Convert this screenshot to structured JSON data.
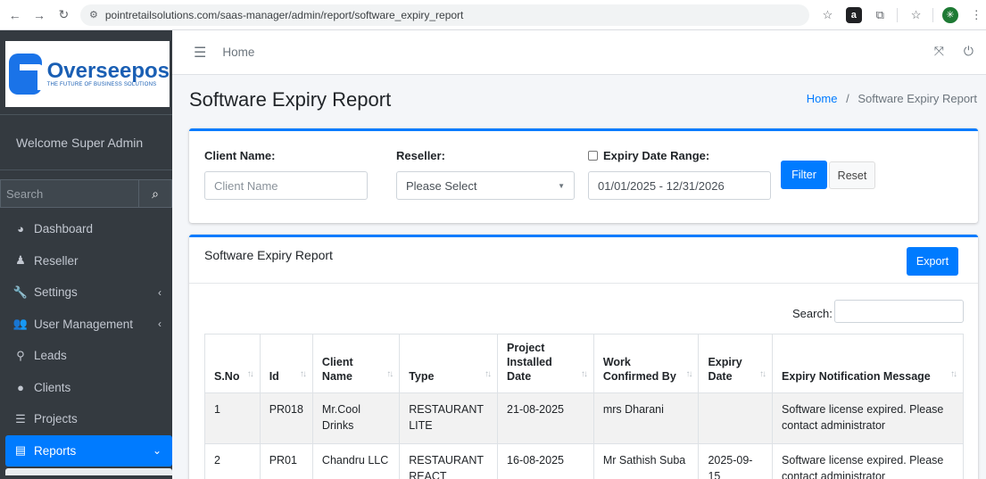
{
  "browser": {
    "url": "pointretailsolutions.com/saas-manager/admin/report/software_expiry_report"
  },
  "sidebar": {
    "brand_name": "Overseepos",
    "brand_tagline": "THE FUTURE OF BUSINESS SOLUTIONS",
    "welcome": "Welcome Super Admin",
    "search_placeholder": "Search",
    "items": [
      {
        "label": "Dashboard",
        "icon": "dashboard-icon"
      },
      {
        "label": "Reseller",
        "icon": "reseller-icon"
      },
      {
        "label": "Settings",
        "icon": "wrench-icon",
        "has_children": true
      },
      {
        "label": "User Management",
        "icon": "users-icon",
        "has_children": true
      },
      {
        "label": "Leads",
        "icon": "leads-icon"
      },
      {
        "label": "Clients",
        "icon": "user-icon"
      },
      {
        "label": "Projects",
        "icon": "database-icon"
      },
      {
        "label": "Reports",
        "icon": "clipboard-icon",
        "active": true,
        "expanded": true
      }
    ]
  },
  "topbar": {
    "home_label": "Home"
  },
  "header": {
    "title": "Software Expiry Report",
    "breadcrumb_home": "Home",
    "breadcrumb_sep": "/",
    "breadcrumb_current": "Software Expiry Report"
  },
  "filters": {
    "client_label": "Client Name:",
    "client_placeholder": "Client Name",
    "reseller_label": "Reseller:",
    "reseller_value": "Please Select",
    "expiry_label": "Expiry Date Range:",
    "expiry_value": "01/01/2025 - 12/31/2026",
    "filter_button": "Filter",
    "reset_button": "Reset"
  },
  "report": {
    "title": "Software Expiry Report",
    "export_button": "Export",
    "search_label": "Search:",
    "columns": [
      "S.No",
      "Id",
      "Client Name",
      "Type",
      "Project Installed Date",
      "Work Confirmed By",
      "Expiry Date",
      "Expiry Notification Message"
    ],
    "rows": [
      [
        "1",
        "PR018",
        "Mr.Cool Drinks",
        "RESTAURANT LITE",
        "21-08-2025",
        "mrs Dharani",
        "",
        "Software license expired. Please contact administrator"
      ],
      [
        "2",
        "PR01",
        "Chandru LLC",
        "RESTAURANT REACT",
        "16-08-2025",
        "Mr Sathish Suba",
        "2025-09-15",
        "Software license expired. Please contact administrator"
      ]
    ]
  },
  "colors": {
    "primary": "#007bff",
    "sidebar_bg": "#343a40"
  }
}
